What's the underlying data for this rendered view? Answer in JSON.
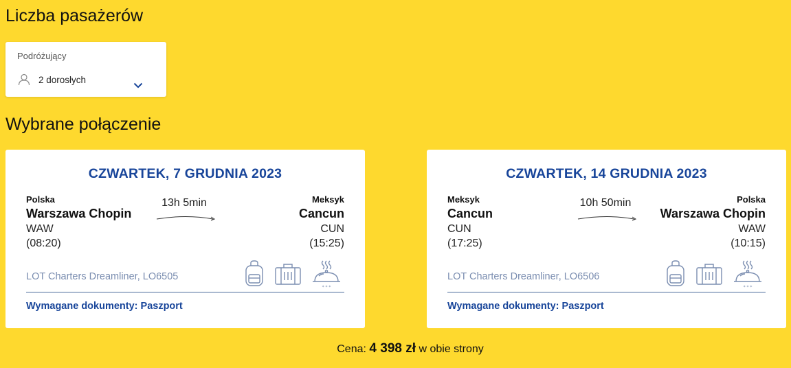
{
  "passengers": {
    "section_title": "Liczba pasażerów",
    "field_label": "Podróżujący",
    "value": "2 dorosłych"
  },
  "selection": {
    "section_title": "Wybrane połączenie"
  },
  "outbound": {
    "date": "CZWARTEK, 7 GRUDNIA 2023",
    "from_country": "Polska",
    "from_city": "Warszawa Chopin",
    "from_code": "WAW",
    "from_time": "(08:20)",
    "duration": "13h 5min",
    "to_country": "Meksyk",
    "to_city": "Cancun",
    "to_code": "CUN",
    "to_time": "(15:25)",
    "aircraft": "LOT Charters Dreamliner, LO6505",
    "documents": "Wymagane dokumenty: Paszport"
  },
  "return": {
    "date": "CZWARTEK, 14 GRUDNIA 2023",
    "from_country": "Meksyk",
    "from_city": "Cancun",
    "from_code": "CUN",
    "from_time": "(17:25)",
    "duration": "10h 50min",
    "to_country": "Polska",
    "to_city": "Warszawa Chopin",
    "to_code": "WAW",
    "to_time": "(10:15)",
    "aircraft": "LOT Charters Dreamliner, LO6506",
    "documents": "Wymagane dokumenty: Paszport"
  },
  "amenity_icons": [
    "backpack-icon",
    "suitcase-icon",
    "meal-icon"
  ],
  "price": {
    "label": "Cena:",
    "amount": "4 398 zł",
    "suffix": "w obie strony"
  },
  "colors": {
    "background": "#fed92e",
    "brand_blue": "#18459a",
    "muted_blue": "#7a8db0",
    "card": "#ffffff"
  }
}
